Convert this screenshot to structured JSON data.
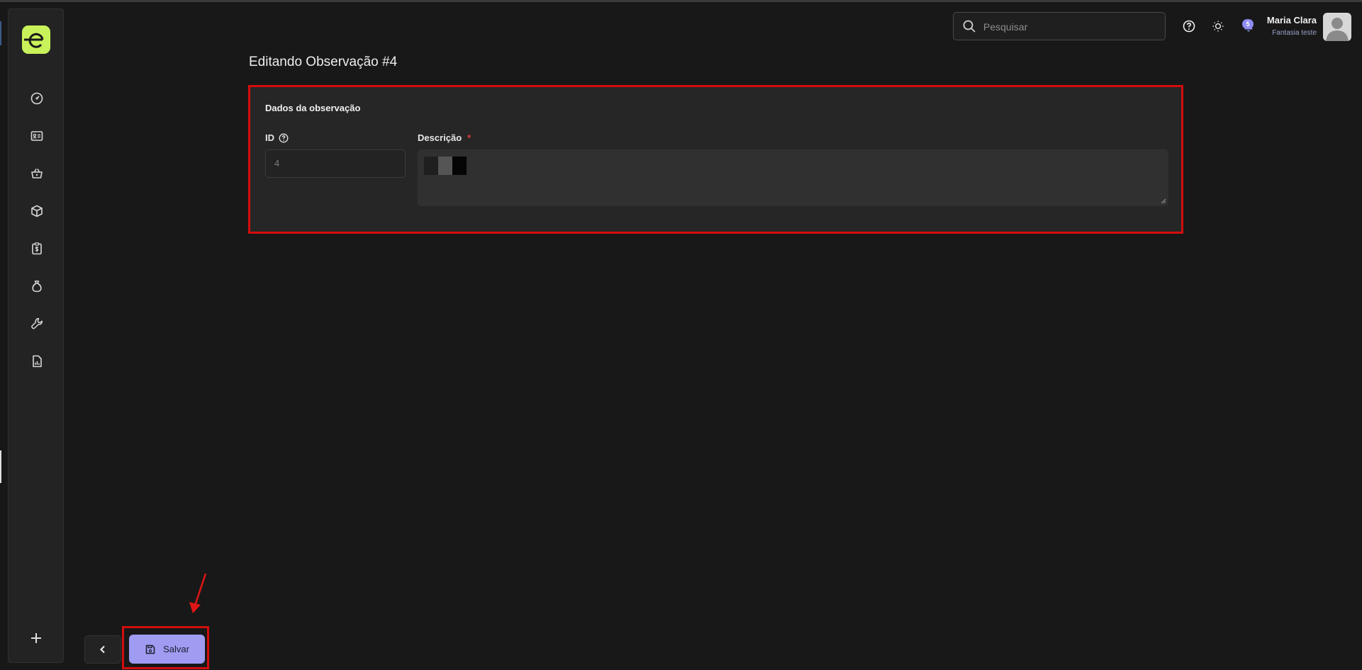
{
  "header": {
    "search_placeholder": "Pesquisar",
    "notifications_count": "5",
    "user_name": "Maria Clara",
    "user_company": "Fantasia teste"
  },
  "sidebar": {
    "logo_letter": "e",
    "items": [
      {
        "icon": "dashboard-gauge-icon"
      },
      {
        "icon": "contact-card-icon"
      },
      {
        "icon": "shopping-basket-icon"
      },
      {
        "icon": "box-package-icon"
      },
      {
        "icon": "clipboard-dollar-icon"
      },
      {
        "icon": "money-bag-icon"
      },
      {
        "icon": "wrench-tools-icon"
      },
      {
        "icon": "report-chart-icon"
      }
    ]
  },
  "page": {
    "title": "Editando Observação #4"
  },
  "form": {
    "section_title": "Dados da observação",
    "id_label": "ID",
    "id_value": "4",
    "description_label": "Descrição",
    "required_mark": "*"
  },
  "actions": {
    "save_label": "Salvar"
  },
  "colors": {
    "background": "#181818",
    "accent": "#9f9cf2",
    "logo": "#c9f25a",
    "highlight": "#d40d0d"
  }
}
